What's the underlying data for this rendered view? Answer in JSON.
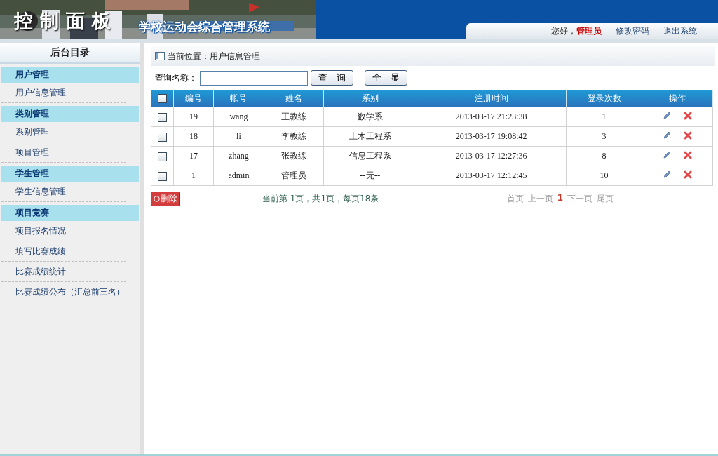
{
  "header": {
    "logo_title": "控制面板",
    "system_name": "学校运动会综合管理系统",
    "greeting": "您好，",
    "user": "管理员",
    "links": [
      "修改密码",
      "退出系统"
    ]
  },
  "sidebar": {
    "title": "后台目录",
    "sections": [
      {
        "label": "用户管理",
        "items": [
          "用户信息管理"
        ]
      },
      {
        "label": "类别管理",
        "items": [
          "系别管理",
          "项目管理"
        ]
      },
      {
        "label": "学生管理",
        "items": [
          "学生信息管理"
        ]
      },
      {
        "label": "项目竞赛",
        "items": [
          "项目报名情况",
          "填写比赛成绩",
          "比赛成绩统计",
          "比赛成绩公布（汇总前三名）"
        ]
      }
    ]
  },
  "breadcrumb": "当前位置：用户信息管理",
  "search": {
    "label": "查询名称：",
    "buttons": [
      "查　询",
      "全　显"
    ]
  },
  "table": {
    "select_all": {
      "checked": false
    },
    "columns": [
      "编号",
      "帐号",
      "姓名",
      "系别",
      "注册时间",
      "登录次数",
      "操作"
    ],
    "rows": [
      {
        "checked": false,
        "cells": [
          "19",
          "wang",
          "王教练",
          "数学系",
          "2013-03-17 21:23:38",
          "1"
        ]
      },
      {
        "checked": false,
        "cells": [
          "18",
          "li",
          "李教练",
          "土木工程系",
          "2013-03-17 19:08:42",
          "3"
        ]
      },
      {
        "checked": false,
        "cells": [
          "17",
          "zhang",
          "张教练",
          "信息工程系",
          "2013-03-17 12:27:36",
          "8"
        ]
      },
      {
        "checked": false,
        "cells": [
          "1",
          "admin",
          "管理员",
          "--无--",
          "2013-03-17 12:12:45",
          "10"
        ]
      }
    ]
  },
  "delete_button": "删除",
  "page_info": "当前第 1页，共1页，每页18条",
  "pager": [
    {
      "label": "首页",
      "selected": false
    },
    {
      "label": "上一页",
      "selected": false
    },
    {
      "label": "1",
      "selected": true
    },
    {
      "label": "下一页",
      "selected": false
    },
    {
      "label": "尾页",
      "selected": false
    }
  ]
}
